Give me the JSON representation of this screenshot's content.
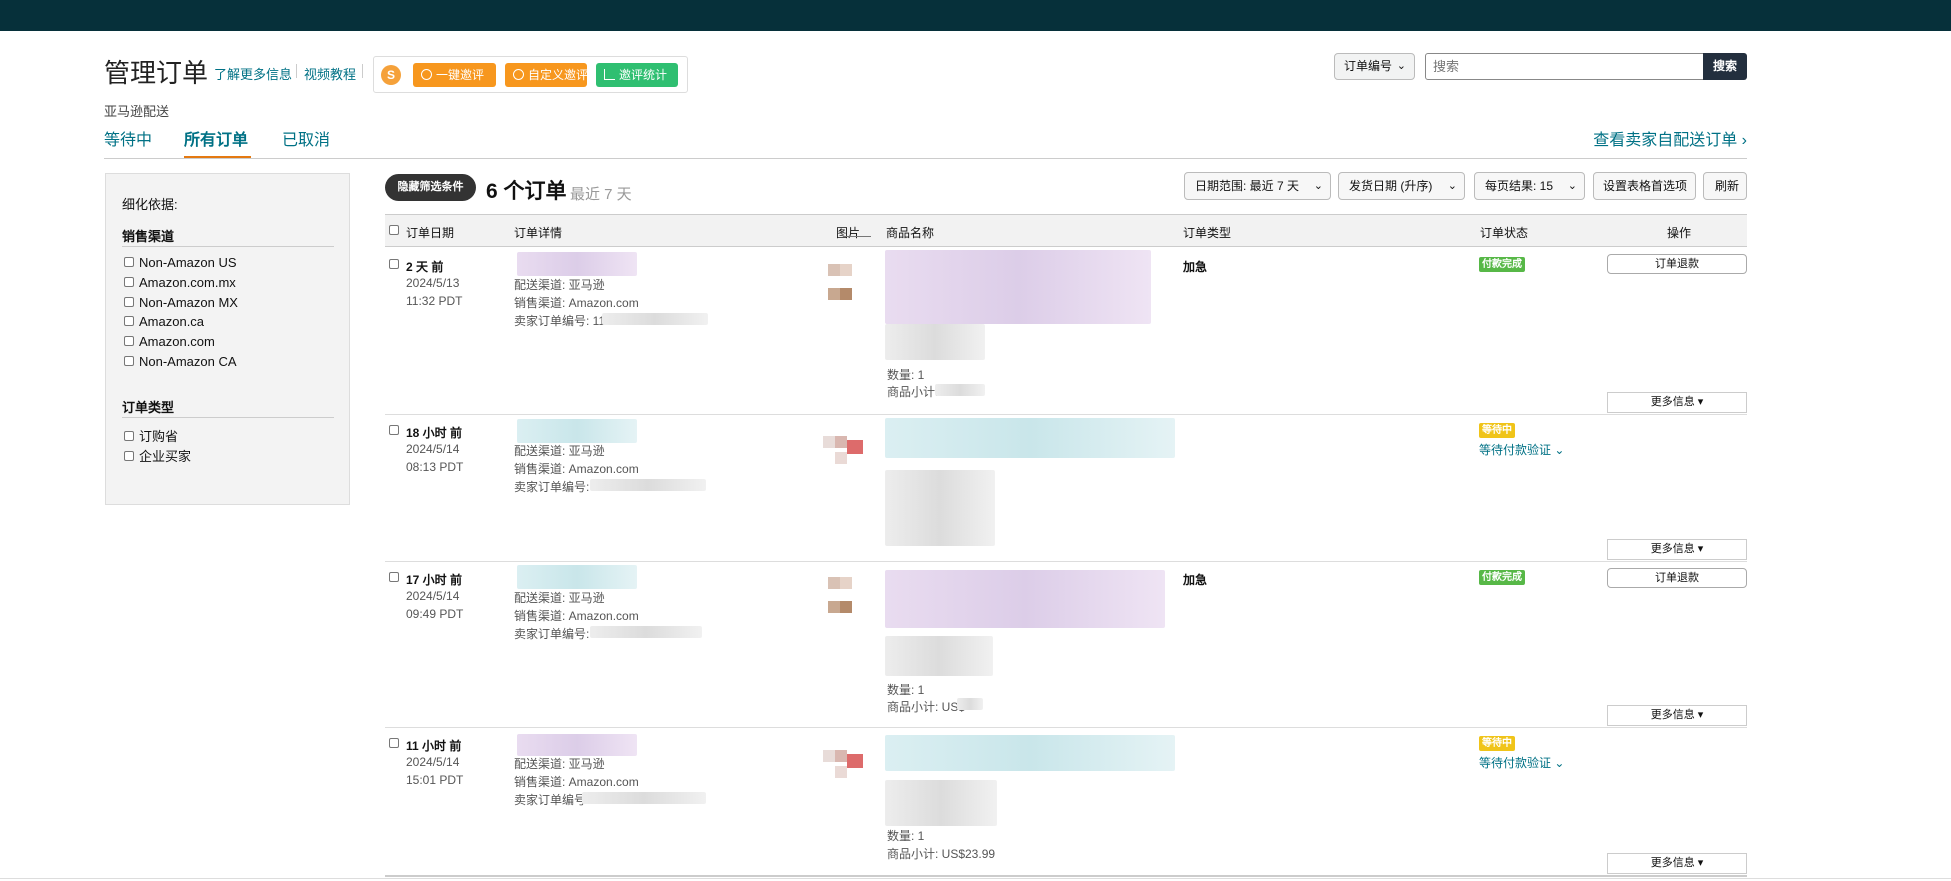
{
  "header": {
    "title": "管理订单",
    "learn_more": "了解更多信息",
    "video_tutorial": "视频教程"
  },
  "extension": {
    "logo": "S",
    "one_click_review": "一键邀评",
    "custom_review": "自定义邀评",
    "review_stats": "邀评统计"
  },
  "search": {
    "field_select": "订单编号",
    "placeholder": "搜索",
    "button": "搜索"
  },
  "fulfillment_label": "亚马逊配送",
  "tabs": [
    "等待中",
    "所有订单",
    "已取消"
  ],
  "view_seller_orders": "查看卖家自配送订单 ›",
  "sidebar": {
    "title": "细化依据:",
    "sales_channel_heading": "销售渠道",
    "sales_channels": [
      "Non-Amazon US",
      "Amazon.com.mx",
      "Non-Amazon MX",
      "Amazon.ca",
      "Amazon.com",
      "Non-Amazon CA"
    ],
    "order_type_heading": "订单类型",
    "order_types": [
      "订购省",
      "企业买家"
    ]
  },
  "toolbar": {
    "hide_filters": "隐藏筛选条件",
    "order_count": "6 个订单",
    "recent": "最近 7 天",
    "date_range": "日期范围: 最近 7 天",
    "ship_date": "发货日期 (升序)",
    "per_page": "每页结果: 15",
    "table_prefs": "设置表格首选项",
    "refresh": "刷新"
  },
  "table": {
    "headers": {
      "date": "订单日期",
      "details": "订单详情",
      "image": "图片",
      "product": "商品名称",
      "type": "订单类型",
      "status": "订单状态",
      "action": "操作"
    },
    "rows": [
      {
        "when": "2 天 前",
        "date": "2024/5/13",
        "time": "11:32 PDT",
        "shipping": "配送渠道: 亚马逊",
        "sales": "销售渠道: Amazon.com",
        "seller_order": "卖家订单编号: 113",
        "qty": "数量: 1",
        "subtotal": "商品小计:",
        "type": "加急",
        "status": "付款完成",
        "status_kind": "paid",
        "action": "订单退款",
        "more": "更多信息 ▾"
      },
      {
        "when": "18 小时 前",
        "date": "2024/5/14",
        "time": "08:13 PDT",
        "shipping": "配送渠道: 亚马逊",
        "sales": "销售渠道: Amazon.com",
        "seller_order": "卖家订单编号: 1",
        "status": "等待中",
        "status_kind": "pending",
        "verify": "等待付款验证 ⌄",
        "more": "更多信息 ▾"
      },
      {
        "when": "17 小时 前",
        "date": "2024/5/14",
        "time": "09:49 PDT",
        "shipping": "配送渠道: 亚马逊",
        "sales": "销售渠道: Amazon.com",
        "seller_order": "卖家订单编号: 1",
        "qty": "数量: 1",
        "subtotal": "商品小计: US$",
        "type": "加急",
        "status": "付款完成",
        "status_kind": "paid",
        "action": "订单退款",
        "more": "更多信息 ▾"
      },
      {
        "when": "11 小时 前",
        "date": "2024/5/14",
        "time": "15:01 PDT",
        "shipping": "配送渠道: 亚马逊",
        "sales": "销售渠道: Amazon.com",
        "seller_order": "卖家订单编号:",
        "qty": "数量: 1",
        "subtotal": "商品小计: US$23.99",
        "status": "等待中",
        "status_kind": "pending",
        "verify": "等待付款验证 ⌄",
        "more": "更多信息 ▾"
      }
    ]
  },
  "colors": {
    "topbar": "#06303a",
    "link": "#007185",
    "ext_orange": "#f7971e",
    "ext_green": "#2fbf71",
    "badge_paid": "#57b847",
    "badge_pending": "#f0c419"
  }
}
